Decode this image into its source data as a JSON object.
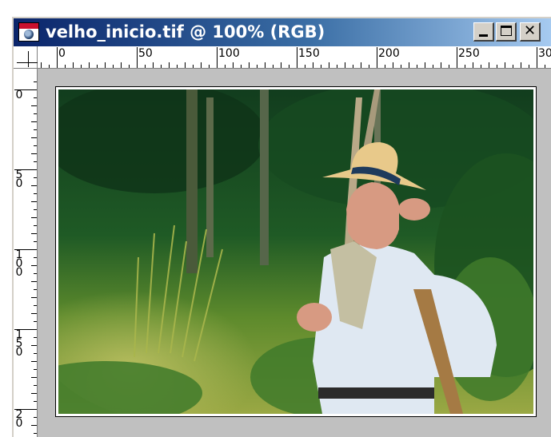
{
  "window": {
    "title": "velho_inicio.tif @ 100% (RGB)",
    "controls": {
      "minimize": "minimize",
      "maximize": "maximize",
      "close": "close"
    }
  },
  "ruler": {
    "horizontal_labels": [
      "0",
      "50",
      "100",
      "150",
      "200",
      "250",
      "30"
    ],
    "vertical_labels": [
      [
        "0"
      ],
      [
        "5",
        "0"
      ],
      [
        "1",
        "0",
        "0"
      ],
      [
        "1",
        "5",
        "0"
      ],
      [
        "2",
        "0"
      ]
    ]
  },
  "colors": {
    "titlebar_start": "#0a246a",
    "titlebar_end": "#a6caf0",
    "window_face": "#d4d0c8",
    "canvas_background": "#c0c0c0"
  },
  "icons": [
    "photoshop-document-icon",
    "minimize-icon",
    "maximize-icon",
    "close-icon"
  ]
}
